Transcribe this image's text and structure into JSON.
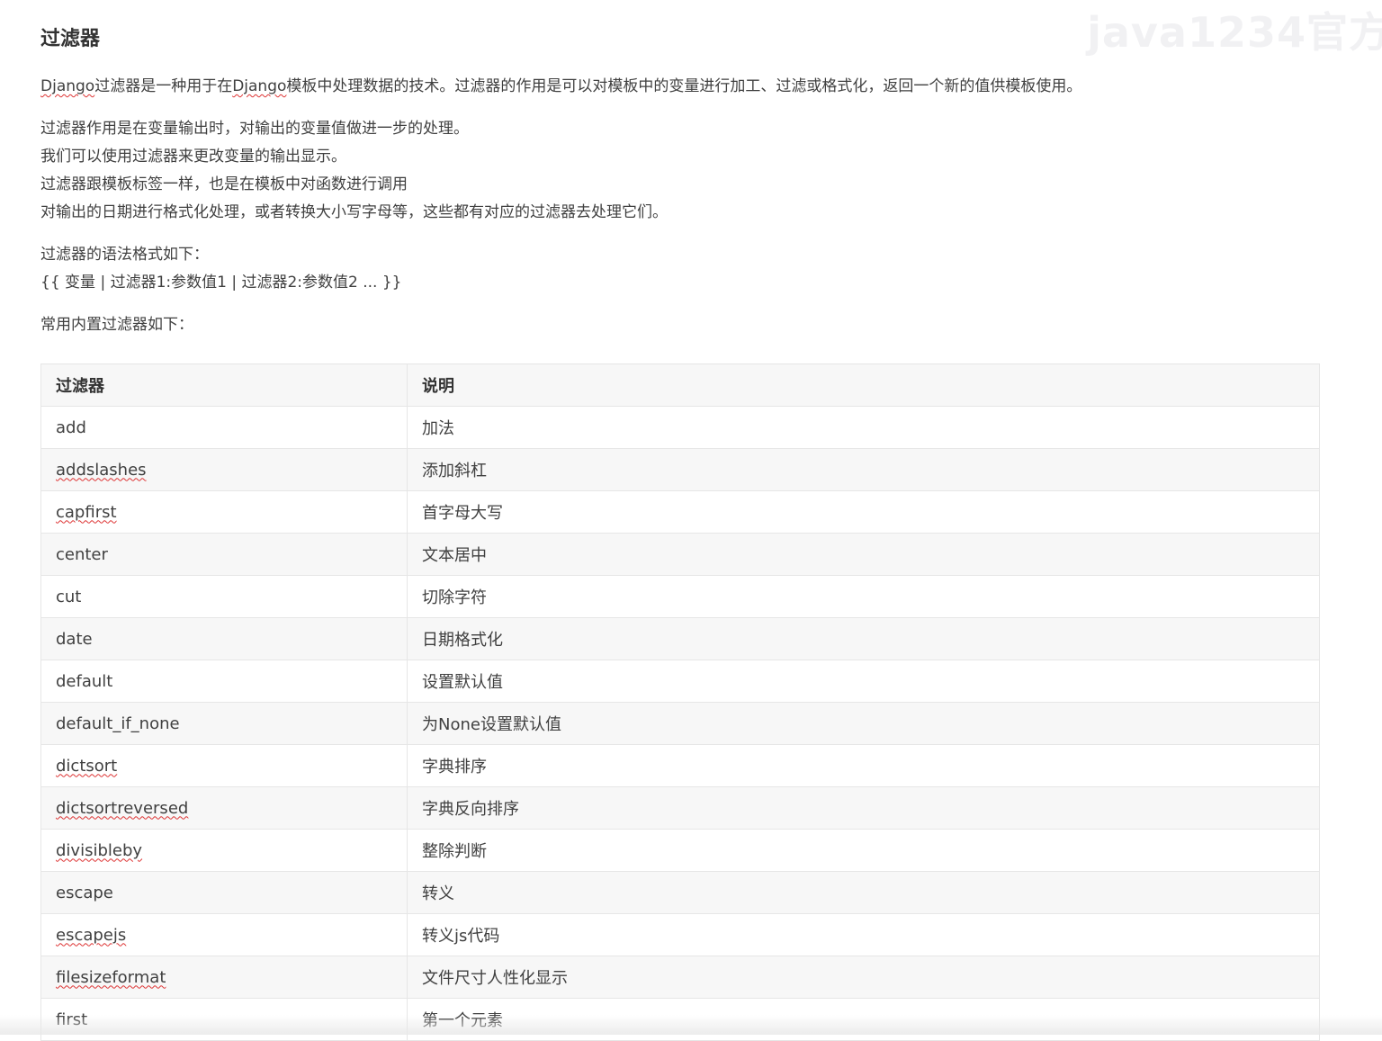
{
  "watermark": "java1234官方",
  "heading": "过滤器",
  "intro": {
    "before": "",
    "word1": "Django",
    "middle": "过滤器是一种用于在",
    "word2": "Django",
    "after": "模板中处理数据的技术。过滤器的作用是可以对模板中的变量进行加工、过滤或格式化，返回一个新的值供模板使用。"
  },
  "usage_lines": [
    "过滤器作用是在变量输出时，对输出的变量值做进一步的处理。",
    "我们可以使用过滤器来更改变量的输出显示。",
    "过滤器跟模板标签一样，也是在模板中对函数进行调用",
    "对输出的日期进行格式化处理，或者转换大小写字母等，这些都有对应的过滤器去处理它们。"
  ],
  "syntax_lines": [
    "过滤器的语法格式如下：",
    "{{ 变量 | 过滤器1:参数值1 | 过滤器2:参数值2 ... }}"
  ],
  "common_label": "常用内置过滤器如下：",
  "table": {
    "headers": [
      "过滤器",
      "说明"
    ],
    "rows": [
      {
        "name": "add",
        "desc": "加法"
      },
      {
        "name": "addslashes",
        "desc": "添加斜杠"
      },
      {
        "name": "capfirst",
        "desc": "首字母大写"
      },
      {
        "name": "center",
        "desc": "文本居中"
      },
      {
        "name": "cut",
        "desc": "切除字符"
      },
      {
        "name": "date",
        "desc": "日期格式化"
      },
      {
        "name": "default",
        "desc": "设置默认值"
      },
      {
        "name": "default_if_none",
        "desc": "为None设置默认值"
      },
      {
        "name": "dictsort",
        "desc": "字典排序"
      },
      {
        "name": "dictsortreversed",
        "desc": "字典反向排序"
      },
      {
        "name": "divisibleby",
        "desc": "整除判断"
      },
      {
        "name": "escape",
        "desc": "转义"
      },
      {
        "name": "escapejs",
        "desc": "转义js代码"
      },
      {
        "name": "filesizeformat",
        "desc": "文件尺寸人性化显示"
      },
      {
        "name": "first",
        "desc": "第一个元素"
      }
    ]
  }
}
